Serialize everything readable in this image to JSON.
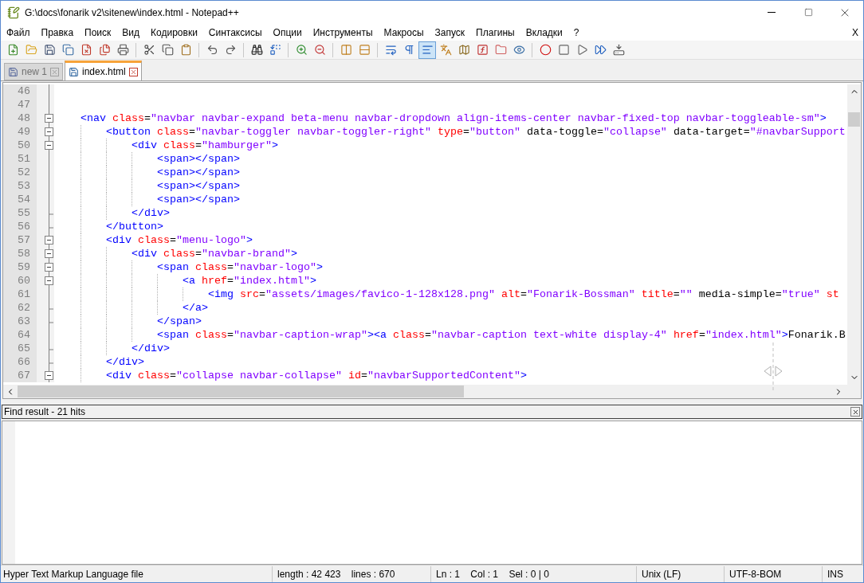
{
  "window": {
    "title": "G:\\docs\\fonarik v2\\sitenew\\index.html - Notepad++"
  },
  "menu": [
    "Файл",
    "Правка",
    "Поиск",
    "Вид",
    "Кодировки",
    "Синтаксисы",
    "Опции",
    "Инструменты",
    "Макросы",
    "Запуск",
    "Плагины",
    "Вкладки",
    "?"
  ],
  "menu_close": "X",
  "toolbar": [
    {
      "kind": "new",
      "selected": false
    },
    {
      "kind": "open",
      "selected": false
    },
    {
      "kind": "save",
      "selected": false
    },
    {
      "kind": "save-all",
      "selected": false
    },
    {
      "kind": "close",
      "selected": false
    },
    {
      "kind": "close-all",
      "selected": false
    },
    {
      "kind": "print",
      "selected": false
    },
    {
      "kind": "separator"
    },
    {
      "kind": "cut",
      "selected": false
    },
    {
      "kind": "copy",
      "selected": false
    },
    {
      "kind": "paste",
      "selected": false
    },
    {
      "kind": "separator"
    },
    {
      "kind": "undo",
      "selected": false
    },
    {
      "kind": "redo",
      "selected": false
    },
    {
      "kind": "separator"
    },
    {
      "kind": "find",
      "selected": false
    },
    {
      "kind": "replace",
      "selected": false
    },
    {
      "kind": "separator"
    },
    {
      "kind": "zoom-in",
      "selected": false
    },
    {
      "kind": "zoom-out",
      "selected": false
    },
    {
      "kind": "separator"
    },
    {
      "kind": "sync-v",
      "selected": false
    },
    {
      "kind": "sync-h",
      "selected": false
    },
    {
      "kind": "separator"
    },
    {
      "kind": "wrap",
      "selected": false
    },
    {
      "kind": "pilcrow",
      "selected": false
    },
    {
      "kind": "indent-guide",
      "selected": true
    },
    {
      "kind": "lang",
      "selected": false
    },
    {
      "kind": "map",
      "selected": false
    },
    {
      "kind": "function",
      "selected": false
    },
    {
      "kind": "folder",
      "selected": false
    },
    {
      "kind": "monitor",
      "selected": false
    },
    {
      "kind": "separator"
    },
    {
      "kind": "record",
      "selected": false
    },
    {
      "kind": "stop",
      "selected": false
    },
    {
      "kind": "play",
      "selected": false
    },
    {
      "kind": "play-multi",
      "selected": false
    },
    {
      "kind": "save-macro",
      "selected": false
    }
  ],
  "tabs": [
    {
      "label": "new 1",
      "selected": false
    },
    {
      "label": "index.html",
      "selected": true
    }
  ],
  "editor": {
    "lines": [
      {
        "number": "46",
        "kind": "inner"
      },
      {
        "number": "47",
        "kind": "inner"
      },
      {
        "number": "48",
        "kind": "open",
        "tokens": [
          {
            "kind": "tag",
            "text": "    <nav "
          },
          {
            "kind": "attr",
            "text": "class"
          },
          {
            "kind": "plain",
            "text": "="
          },
          {
            "kind": "value",
            "text": "\"navbar navbar-expand beta-menu navbar-dropdown align-items-center navbar-fixed-top navbar-toggleable-sm\""
          },
          {
            "kind": "tag",
            "text": ">"
          }
        ]
      },
      {
        "number": "49",
        "kind": "open",
        "tokens": [
          {
            "kind": "tag",
            "text": "        <button "
          },
          {
            "kind": "attr",
            "text": "class"
          },
          {
            "kind": "plain",
            "text": "="
          },
          {
            "kind": "value",
            "text": "\"navbar-toggler navbar-toggler-right\" "
          },
          {
            "kind": "attr",
            "text": "type"
          },
          {
            "kind": "plain",
            "text": "="
          },
          {
            "kind": "value",
            "text": "\"button\" "
          },
          {
            "kind": "plain",
            "text": "data-toggle="
          },
          {
            "kind": "value",
            "text": "\"collapse\" "
          },
          {
            "kind": "plain",
            "text": "data-target="
          },
          {
            "kind": "value",
            "text": "\"#navbarSupport"
          }
        ]
      },
      {
        "number": "50",
        "kind": "open",
        "tokens": [
          {
            "kind": "tag",
            "text": "            <div "
          },
          {
            "kind": "attr",
            "text": "class"
          },
          {
            "kind": "plain",
            "text": "="
          },
          {
            "kind": "value",
            "text": "\"hamburger\""
          },
          {
            "kind": "tag",
            "text": ">"
          }
        ]
      },
      {
        "number": "51",
        "kind": "inner",
        "tokens": [
          {
            "kind": "tag",
            "text": "                <span></span>"
          }
        ]
      },
      {
        "number": "52",
        "kind": "inner",
        "tokens": [
          {
            "kind": "tag",
            "text": "                <span></span>"
          }
        ]
      },
      {
        "number": "53",
        "kind": "inner",
        "tokens": [
          {
            "kind": "tag",
            "text": "                <span></span>"
          }
        ]
      },
      {
        "number": "54",
        "kind": "inner",
        "tokens": [
          {
            "kind": "tag",
            "text": "                <span></span>"
          }
        ]
      },
      {
        "number": "55",
        "kind": "end",
        "tokens": [
          {
            "kind": "tag",
            "text": "            </div>"
          }
        ]
      },
      {
        "number": "56",
        "kind": "end",
        "tokens": [
          {
            "kind": "tag",
            "text": "        </button>"
          }
        ]
      },
      {
        "number": "57",
        "kind": "open",
        "tokens": [
          {
            "kind": "tag",
            "text": "        <div "
          },
          {
            "kind": "attr",
            "text": "class"
          },
          {
            "kind": "plain",
            "text": "="
          },
          {
            "kind": "value",
            "text": "\"menu-logo\""
          },
          {
            "kind": "tag",
            "text": ">"
          }
        ]
      },
      {
        "number": "58",
        "kind": "open",
        "tokens": [
          {
            "kind": "tag",
            "text": "            <div "
          },
          {
            "kind": "attr",
            "text": "class"
          },
          {
            "kind": "plain",
            "text": "="
          },
          {
            "kind": "value",
            "text": "\"navbar-brand\""
          },
          {
            "kind": "tag",
            "text": ">"
          }
        ]
      },
      {
        "number": "59",
        "kind": "open",
        "tokens": [
          {
            "kind": "tag",
            "text": "                <span "
          },
          {
            "kind": "attr",
            "text": "class"
          },
          {
            "kind": "plain",
            "text": "="
          },
          {
            "kind": "value",
            "text": "\"navbar-logo\""
          },
          {
            "kind": "tag",
            "text": ">"
          }
        ]
      },
      {
        "number": "60",
        "kind": "open",
        "tokens": [
          {
            "kind": "tag",
            "text": "                    <a "
          },
          {
            "kind": "attr",
            "text": "href"
          },
          {
            "kind": "plain",
            "text": "="
          },
          {
            "kind": "value",
            "text": "\"index.html\""
          },
          {
            "kind": "tag",
            "text": ">"
          }
        ]
      },
      {
        "number": "61",
        "kind": "inner",
        "tokens": [
          {
            "kind": "tag",
            "text": "                        <img "
          },
          {
            "kind": "attr",
            "text": "src"
          },
          {
            "kind": "plain",
            "text": "="
          },
          {
            "kind": "value",
            "text": "\"assets/images/favico-1-128x128.png\" "
          },
          {
            "kind": "attr",
            "text": "alt"
          },
          {
            "kind": "plain",
            "text": "="
          },
          {
            "kind": "value",
            "text": "\"Fonarik-Bossman\" "
          },
          {
            "kind": "attr",
            "text": "title"
          },
          {
            "kind": "plain",
            "text": "="
          },
          {
            "kind": "value",
            "text": "\"\" "
          },
          {
            "kind": "plain",
            "text": "media-simple="
          },
          {
            "kind": "value",
            "text": "\"true\" "
          },
          {
            "kind": "attr",
            "text": "st"
          }
        ]
      },
      {
        "number": "62",
        "kind": "end",
        "tokens": [
          {
            "kind": "tag",
            "text": "                    </a>"
          }
        ]
      },
      {
        "number": "63",
        "kind": "end",
        "tokens": [
          {
            "kind": "tag",
            "text": "                </span>"
          }
        ]
      },
      {
        "number": "64",
        "kind": "inner",
        "tokens": [
          {
            "kind": "tag",
            "text": "                <span "
          },
          {
            "kind": "attr",
            "text": "class"
          },
          {
            "kind": "plain",
            "text": "="
          },
          {
            "kind": "value",
            "text": "\"navbar-caption-wrap\""
          },
          {
            "kind": "tag",
            "text": "><a "
          },
          {
            "kind": "attr",
            "text": "class"
          },
          {
            "kind": "plain",
            "text": "="
          },
          {
            "kind": "value",
            "text": "\"navbar-caption text-white display-4\" "
          },
          {
            "kind": "attr",
            "text": "href"
          },
          {
            "kind": "plain",
            "text": "="
          },
          {
            "kind": "value",
            "text": "\"index.html\""
          },
          {
            "kind": "tag",
            "text": ">"
          },
          {
            "kind": "plain",
            "text": "Fonarik.B"
          }
        ]
      },
      {
        "number": "65",
        "kind": "end",
        "tokens": [
          {
            "kind": "tag",
            "text": "            </div>"
          }
        ]
      },
      {
        "number": "66",
        "kind": "end",
        "tokens": [
          {
            "kind": "tag",
            "text": "        </div>"
          }
        ]
      },
      {
        "number": "67",
        "kind": "open",
        "tokens": [
          {
            "kind": "tag",
            "text": "        <div "
          },
          {
            "kind": "attr",
            "text": "class"
          },
          {
            "kind": "plain",
            "text": "="
          },
          {
            "kind": "value",
            "text": "\"collapse navbar-collapse\" "
          },
          {
            "kind": "attr",
            "text": "id"
          },
          {
            "kind": "plain",
            "text": "="
          },
          {
            "kind": "value",
            "text": "\"navbarSupportedContent\""
          },
          {
            "kind": "tag",
            "text": ">"
          }
        ]
      }
    ]
  },
  "find_panel": {
    "title": "Find result - 21 hits"
  },
  "status_bar": [
    "Hyper Text Markup Language file",
    "length : 42 423    lines : 670",
    "Ln : 1    Col : 1    Sel : 0 | 0",
    "Unix (LF)",
    "UTF-8-BOM",
    "INS"
  ]
}
